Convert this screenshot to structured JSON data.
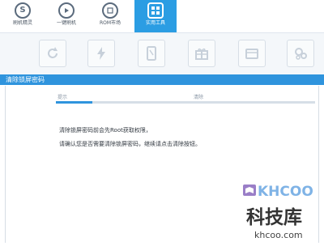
{
  "tabs": [
    {
      "label": "刷机精灵",
      "icon": "s-logo-icon",
      "active": false
    },
    {
      "label": "一键刷机",
      "icon": "play-icon",
      "active": false
    },
    {
      "label": "ROM市场",
      "icon": "rom-market-icon",
      "active": false
    },
    {
      "label": "实用工具",
      "icon": "grid-icon",
      "active": true
    }
  ],
  "toolbar_icons": [
    "refresh-icon",
    "flash-icon",
    "tablet-icon",
    "gift-icon",
    "folder-icon",
    "gears-icon"
  ],
  "section": {
    "title": "清除锁屏密码"
  },
  "steps": {
    "step1": "提示",
    "step2": "清除",
    "progress_fraction": 0.14
  },
  "message": {
    "line1": "清除锁屏密码前会先Root获取权限，",
    "line2": "请确认您是否需要清除锁屏密码，继续请点击清除按钮。"
  },
  "watermark": {
    "brand": "KHCOO",
    "cn": "科技库",
    "url": "khcoo.com"
  },
  "colors": {
    "accent": "#2f94dd",
    "tab_active": "#2b9de3",
    "text": "#333a42"
  }
}
